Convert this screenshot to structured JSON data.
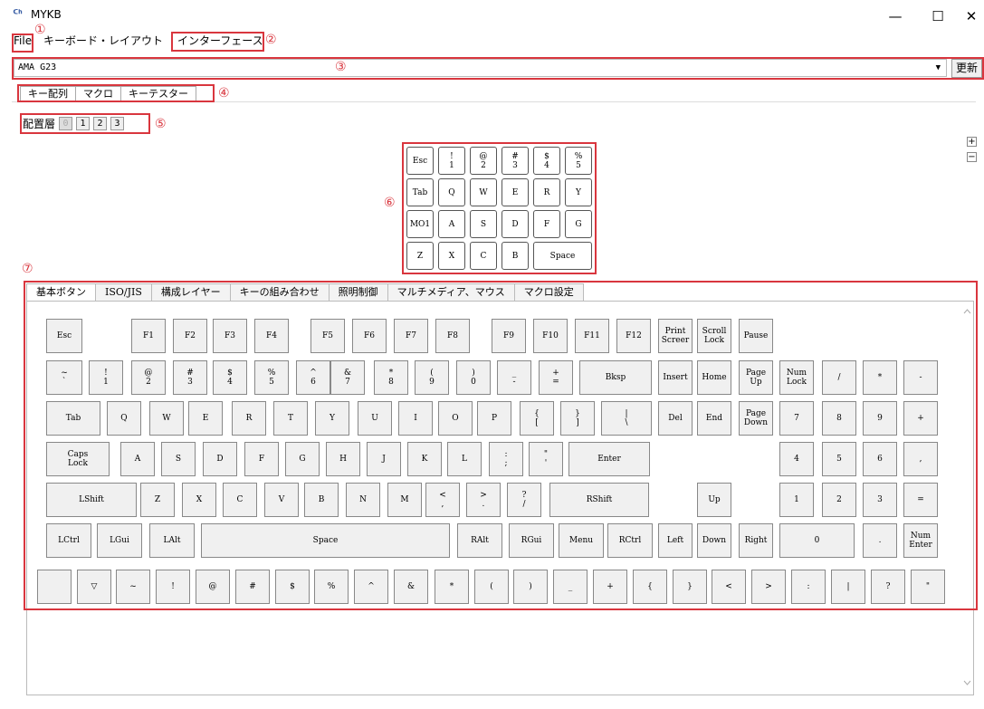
{
  "window": {
    "title": "MYKB",
    "logo": "ᑦᑋ",
    "minimize": "—",
    "maximize": "☐",
    "close": "✕"
  },
  "menu": {
    "file": "File",
    "layout": "キーボード・レイアウト",
    "interface": "インターフェース"
  },
  "annotations": [
    "①",
    "②",
    "③",
    "④",
    "⑤",
    "⑥",
    "⑦"
  ],
  "device": {
    "selected": "AMA G23",
    "refresh": "更新"
  },
  "main_tabs": [
    "キー配列",
    "マクロ",
    "キーテスター"
  ],
  "layers": {
    "label": "配置層",
    "items": [
      "0",
      "1",
      "2",
      "3"
    ],
    "active": "0"
  },
  "zoom": {
    "plus": "+",
    "minus": "−"
  },
  "small_keyboard": [
    [
      "Esc",
      "!\n1",
      "@\n2",
      "#\n3",
      "$\n4",
      "%\n5"
    ],
    [
      "Tab",
      "Q",
      "W",
      "E",
      "R",
      "Y"
    ],
    [
      "MO1",
      "A",
      "S",
      "D",
      "F",
      "G"
    ],
    [
      "Z",
      "X",
      "C",
      "B",
      "Space"
    ]
  ],
  "lower_tabs": [
    "基本ボタン",
    "ISO/JIS",
    "構成レイヤー",
    "キーの組み合わせ",
    "照明制御",
    "マルチメディア、マウス",
    "マクロ設定"
  ],
  "keys": {
    "r1": [
      "Esc",
      "F1",
      "F2",
      "F3",
      "F4",
      "F5",
      "F6",
      "F7",
      "F8",
      "F9",
      "F10",
      "F11",
      "F12",
      "Print\nScreer",
      "Scroll\nLock",
      "Pause"
    ],
    "r2": [
      "~\n`",
      "!\n1",
      "@\n2",
      "#\n3",
      "$\n4",
      "%\n5",
      "^\n6",
      "&\n7",
      "*\n8",
      "(\n9",
      ")\n0",
      "_\n-",
      "+\n=",
      "Bksp",
      "Insert",
      "Home",
      "Page\nUp",
      "Num\nLock",
      "/",
      "*",
      "-"
    ],
    "r3": [
      "Tab",
      "Q",
      "W",
      "E",
      "R",
      "T",
      "Y",
      "U",
      "I",
      "O",
      "P",
      "{\n[",
      "}\n]",
      "|\n\\",
      "Del",
      "End",
      "Page\nDown",
      "7",
      "8",
      "9",
      "+"
    ],
    "r4": [
      "Caps\nLock",
      "A",
      "S",
      "D",
      "F",
      "G",
      "H",
      "J",
      "K",
      "L",
      ":\n;",
      "\"\n'",
      "Enter",
      "4",
      "5",
      "6",
      ","
    ],
    "r5": [
      "LShift",
      "Z",
      "X",
      "C",
      "V",
      "B",
      "N",
      "M",
      "<\n,",
      ">\n.",
      "?\n/",
      "RShift",
      "Up",
      "1",
      "2",
      "3",
      "="
    ],
    "r6": [
      "LCtrl",
      "LGui",
      "LAlt",
      "Space",
      "RAlt",
      "RGui",
      "Menu",
      "RCtrl",
      "Left",
      "Down",
      "Right",
      "0",
      ".",
      "Num\nEnter"
    ],
    "r7": [
      "",
      "▽",
      "~",
      "!",
      "@",
      "#",
      "$",
      "%",
      "^",
      "&",
      "*",
      "(",
      ")",
      "_",
      "+",
      "{",
      "}",
      "<",
      ">",
      ":",
      "|",
      "?",
      "\""
    ]
  }
}
